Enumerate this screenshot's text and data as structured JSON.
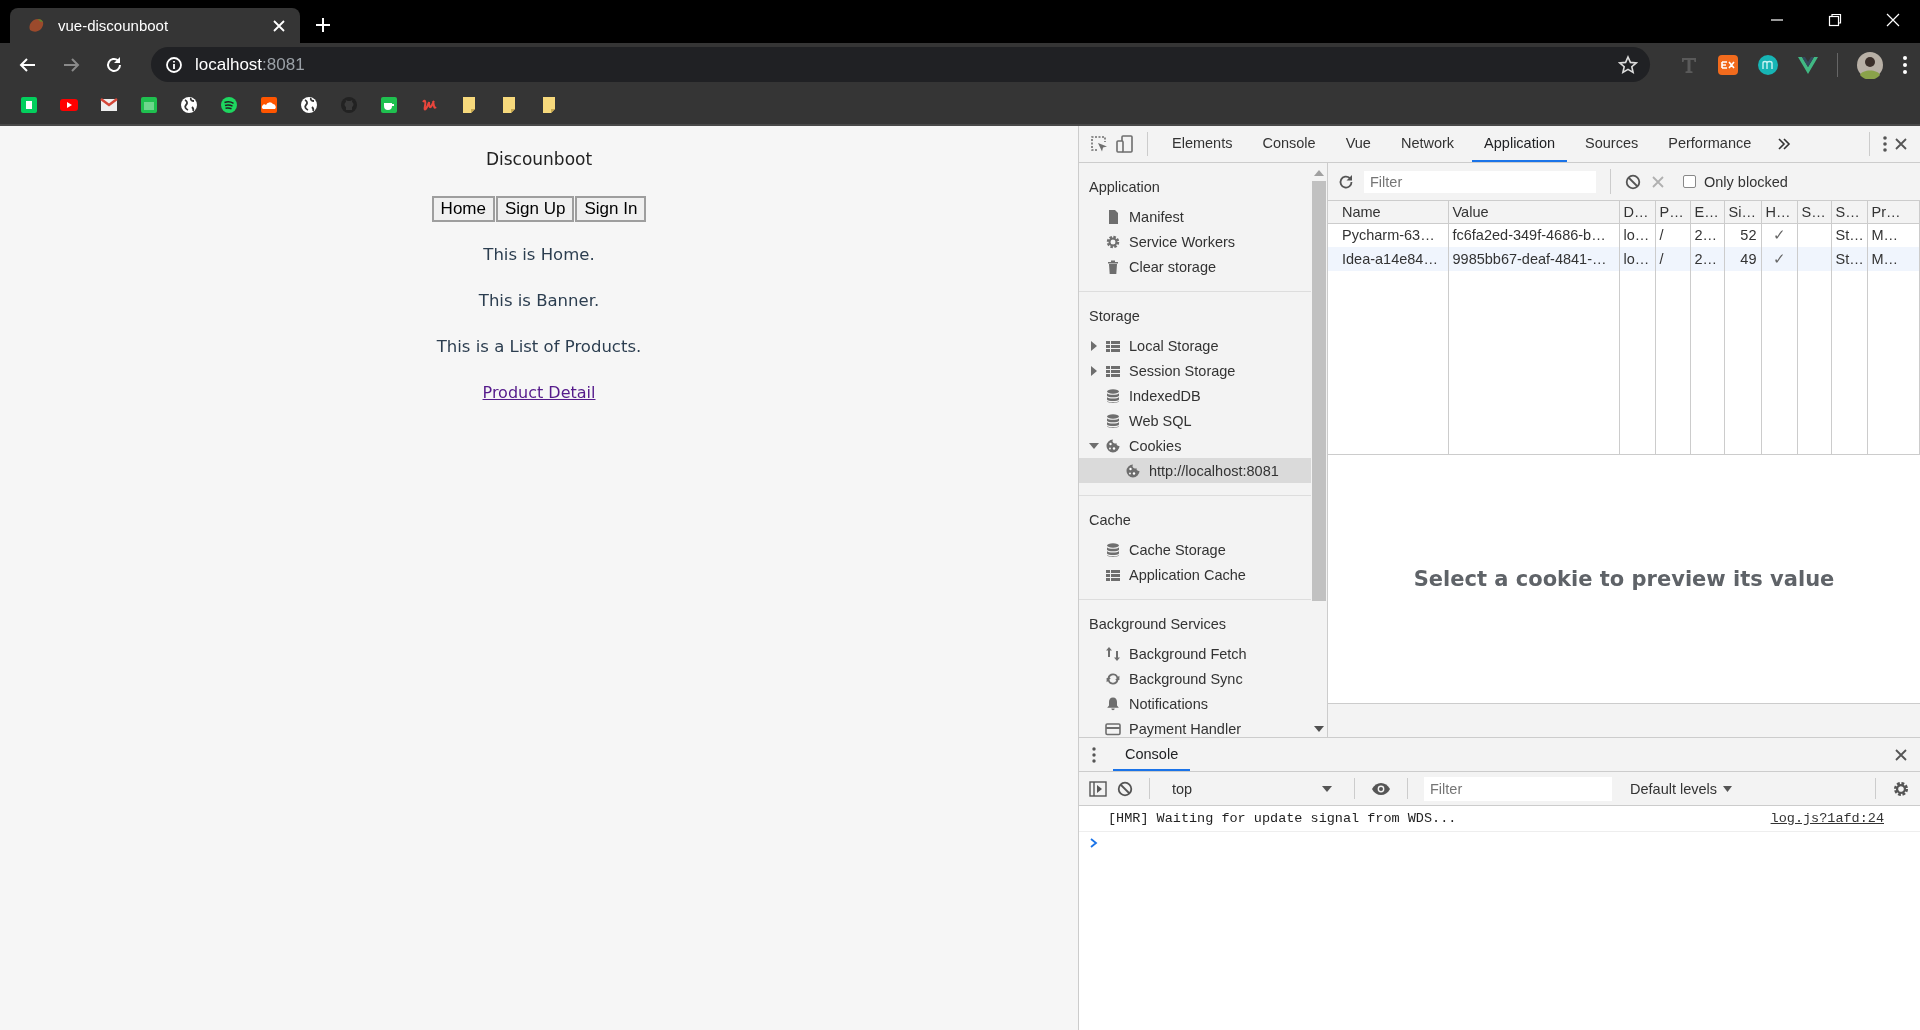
{
  "browser": {
    "tab": {
      "title": "vue-discounboot"
    },
    "address": {
      "host": "localhost",
      "port": ":8081"
    }
  },
  "page": {
    "title": "Discounboot",
    "nav_buttons": [
      "Home",
      "Sign Up",
      "Sign In"
    ],
    "paragraphs": [
      "This is Home.",
      "This is Banner.",
      "This is a List of Products."
    ],
    "link": "Product Detail"
  },
  "devtools": {
    "tabs": [
      {
        "label": "Elements",
        "selected": false
      },
      {
        "label": "Console",
        "selected": false
      },
      {
        "label": "Vue",
        "selected": false
      },
      {
        "label": "Network",
        "selected": false
      },
      {
        "label": "Application",
        "selected": true
      },
      {
        "label": "Sources",
        "selected": false
      },
      {
        "label": "Performance",
        "selected": false
      }
    ],
    "sidebar": [
      {
        "title": "Application",
        "items": [
          {
            "label": "Manifest",
            "kind": "manifest",
            "selected": false
          },
          {
            "label": "Service Workers",
            "kind": "workers",
            "selected": false
          },
          {
            "label": "Clear storage",
            "kind": "clear",
            "selected": false
          }
        ]
      },
      {
        "title": "Storage",
        "items": [
          {
            "label": "Local Storage",
            "kind": "table",
            "expanded": false,
            "selected": false
          },
          {
            "label": "Session Storage",
            "kind": "table",
            "expanded": false,
            "selected": false
          },
          {
            "label": "IndexedDB",
            "kind": "database",
            "selected": false
          },
          {
            "label": "Web SQL",
            "kind": "database",
            "selected": false
          },
          {
            "label": "Cookies",
            "kind": "cookie",
            "expanded": true,
            "selected": false,
            "children": [
              {
                "label": "http://localhost:8081",
                "kind": "cookie",
                "selected": true
              }
            ]
          }
        ]
      },
      {
        "title": "Cache",
        "items": [
          {
            "label": "Cache Storage",
            "kind": "database",
            "selected": false
          },
          {
            "label": "Application Cache",
            "kind": "table",
            "selected": false
          }
        ]
      },
      {
        "title": "Background Services",
        "items": [
          {
            "label": "Background Fetch",
            "kind": "fetch",
            "selected": false
          },
          {
            "label": "Background Sync",
            "kind": "sync",
            "selected": false
          },
          {
            "label": "Notifications",
            "kind": "notifications",
            "selected": false
          },
          {
            "label": "Payment Handler",
            "kind": "payment",
            "selected": false
          }
        ]
      }
    ],
    "cookies": {
      "filter": {
        "placeholder": "Filter"
      },
      "only_blocked": {
        "label": "Only blocked",
        "checked": false
      },
      "columns": [
        "Name",
        "Value",
        "D…",
        "P…",
        "E…",
        "Si…",
        "H…",
        "S…",
        "S…",
        "Pr…"
      ],
      "rows": [
        {
          "cells": [
            "Pycharm-63…",
            "fc6fa2ed-349f-4686-b…",
            "lo…",
            "/",
            "2…",
            "52",
            "✓",
            null,
            "St…",
            "M…"
          ]
        },
        {
          "cells": [
            "Idea-a14e84…",
            "9985bb67-deaf-4841-…",
            "lo…",
            "/",
            "2…",
            "49",
            "✓",
            null,
            "St…",
            "M…"
          ]
        }
      ],
      "preview_message": "Select a cookie to preview its value"
    },
    "drawer": {
      "tabs": [
        {
          "label": "Console",
          "selected": true
        }
      ],
      "context": "top",
      "filter": {
        "placeholder": "Filter"
      },
      "levels": "Default levels",
      "messages": [
        {
          "text": "[HMR] Waiting for update signal from WDS...",
          "source": "log.js?1afd:24"
        }
      ]
    }
  }
}
